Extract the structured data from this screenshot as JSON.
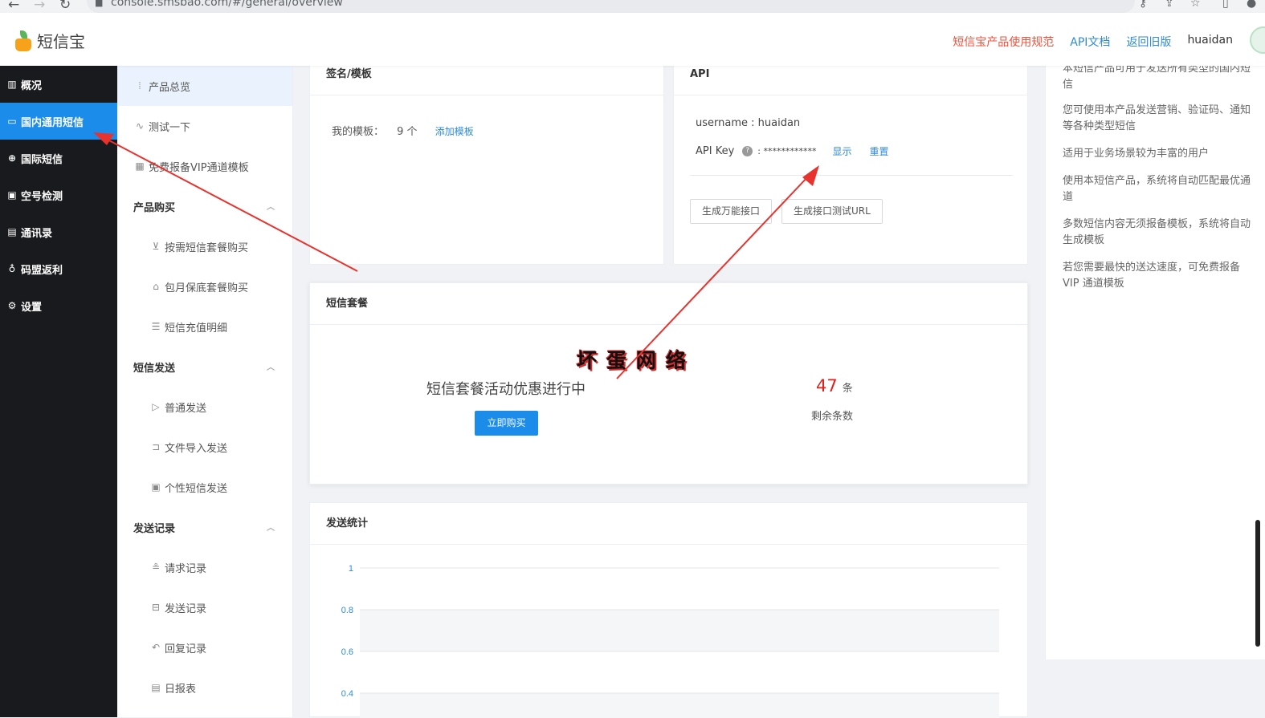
{
  "browser": {
    "url": "console.smsbao.com/#/general/overview"
  },
  "header": {
    "brand": "短信宝",
    "links": [
      "短信宝产品使用规范",
      "API文档",
      "返回旧版"
    ],
    "username": "huaidan"
  },
  "sidebar": {
    "items": [
      {
        "label": "概况",
        "icon": "bar-chart-icon"
      },
      {
        "label": "国内通用短信",
        "icon": "message-icon",
        "active": true
      },
      {
        "label": "国际短信",
        "icon": "globe-icon"
      },
      {
        "label": "空号检测",
        "icon": "check-box-icon"
      },
      {
        "label": "通讯录",
        "icon": "contacts-icon"
      },
      {
        "label": "码盟返利",
        "icon": "gift-icon"
      },
      {
        "label": "设置",
        "icon": "gear-icon"
      }
    ]
  },
  "subnav": {
    "top": [
      {
        "label": "产品总览",
        "icon": "overview-icon",
        "active": true
      },
      {
        "label": "测试一下",
        "icon": "pulse-icon"
      },
      {
        "label": "免费报备VIP通道模板",
        "icon": "template-icon"
      }
    ],
    "groups": [
      {
        "title": "产品购买",
        "children": [
          {
            "label": "按需短信套餐购买",
            "icon": "cart-icon"
          },
          {
            "label": "包月保底套餐购买",
            "icon": "package-icon"
          },
          {
            "label": "短信充值明细",
            "icon": "list-icon"
          }
        ]
      },
      {
        "title": "短信发送",
        "children": [
          {
            "label": "普通发送",
            "icon": "send-icon"
          },
          {
            "label": "文件导入发送",
            "icon": "import-icon"
          },
          {
            "label": "个性短信发送",
            "icon": "custom-icon"
          }
        ]
      },
      {
        "title": "发送记录",
        "children": [
          {
            "label": "请求记录",
            "icon": "request-icon"
          },
          {
            "label": "发送记录",
            "icon": "record-icon"
          },
          {
            "label": "回复记录",
            "icon": "reply-icon"
          },
          {
            "label": "日报表",
            "icon": "report-icon"
          }
        ]
      }
    ]
  },
  "template_card": {
    "title": "签名/模板",
    "label": "我的模板：",
    "count": "9 个",
    "add_link": "添加模板"
  },
  "api_card": {
    "title": "API",
    "username_line": "username : huaidan",
    "key_label": "API Key",
    "key_value": ": ************",
    "show_link": "显示",
    "reset_link": "重置",
    "btn_universal": "生成万能接口",
    "btn_test_url": "生成接口测试URL"
  },
  "package_card": {
    "title": "短信套餐",
    "promo": "短信套餐活动优惠进行中",
    "buy_button": "立即购买",
    "remaining_value": "47",
    "remaining_unit": "条",
    "remaining_label": "剩余条数"
  },
  "stats_card": {
    "title": "发送统计"
  },
  "chart_data": {
    "type": "line",
    "y_ticks": [
      "1",
      "0.8",
      "0.6",
      "0.4"
    ],
    "ylim": [
      0,
      1
    ],
    "grid": true,
    "series": []
  },
  "info": {
    "lines": [
      "本短信产品可用于发送所有类型的国内短信",
      "您可使用本产品发送营销、验证码、通知等各种类型短信",
      "适用于业务场景较为丰富的用户",
      "使用本短信产品，系统将自动匹配最优通道",
      "多数短信内容无须报备模板，系统将自动生成模板",
      "若您需要最快的送达速度，可免费报备VIP 通道模板"
    ]
  },
  "watermark": "坏蛋网络",
  "colors": {
    "primary": "#1c8ceb",
    "sidebar_dark": "#191a1d",
    "link_red": "#f0523d",
    "link_blue": "#2f8ad8",
    "count_red": "#e0201a",
    "arrow_red": "#e8322e"
  }
}
